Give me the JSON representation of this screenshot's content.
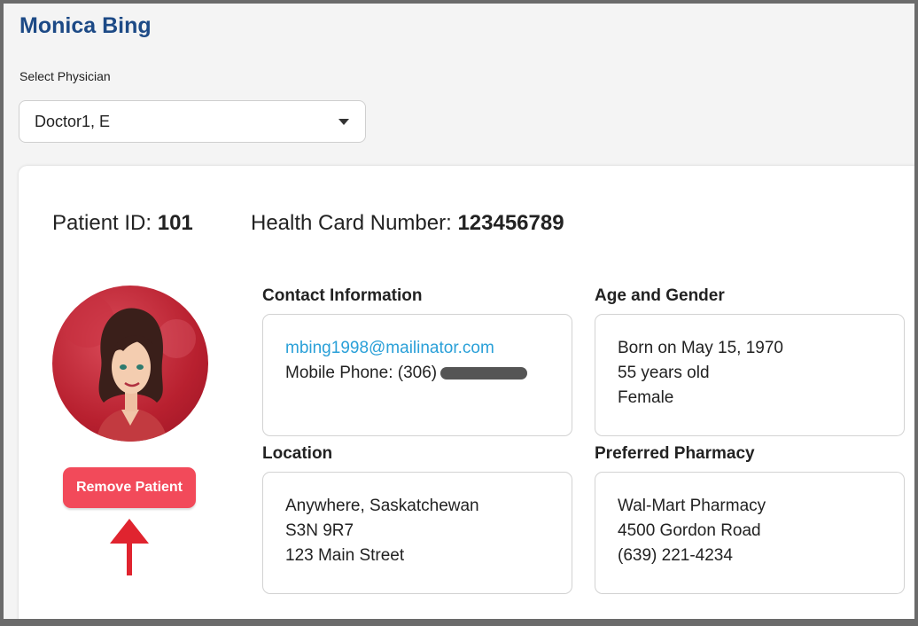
{
  "patient": {
    "name": "Monica Bing",
    "id_label": "Patient ID:",
    "id_value": "101",
    "health_card_label": "Health Card Number:",
    "health_card_value": "123456789"
  },
  "physician": {
    "label": "Select Physician",
    "selected": "Doctor1, E"
  },
  "actions": {
    "remove_label": "Remove Patient"
  },
  "contact": {
    "title": "Contact Information",
    "email": "mbing1998@mailinator.com",
    "phone_label": "Mobile Phone: (306)"
  },
  "age_gender": {
    "title": "Age and Gender",
    "born": "Born on May 15, 1970",
    "age": "55 years old",
    "gender": "Female"
  },
  "location": {
    "title": "Location",
    "city": "Anywhere, Saskatchewan",
    "postal": "S3N 9R7",
    "street": "123 Main Street"
  },
  "pharmacy": {
    "title": "Preferred Pharmacy",
    "name": "Wal-Mart Pharmacy",
    "address": "4500 Gordon Road",
    "phone": "(639) 221-4234"
  },
  "colors": {
    "brand_title": "#1d4a86",
    "danger_button": "#f24a5a",
    "link": "#2aa0d8",
    "annotation_arrow": "#e0242f"
  }
}
